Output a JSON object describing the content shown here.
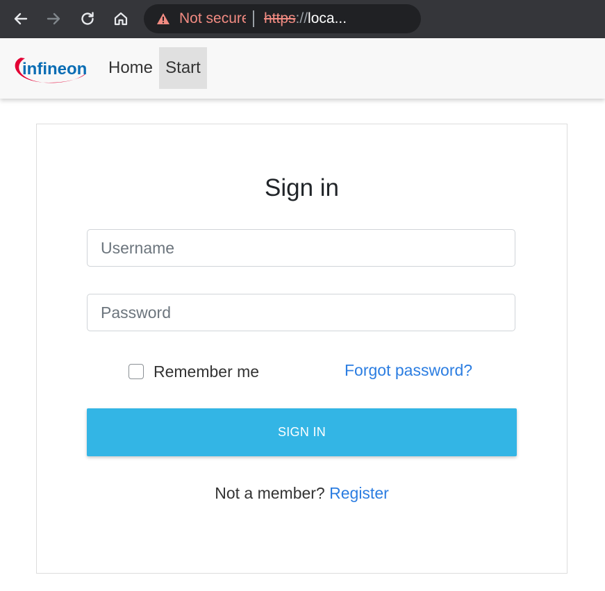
{
  "browser": {
    "security_text": "Not secure",
    "url_scheme": "https",
    "url_separator": "://",
    "url_host": "loca...",
    "icons": [
      "back-icon",
      "forward-icon",
      "reload-icon",
      "home-icon",
      "warning-icon"
    ]
  },
  "navbar": {
    "brand": "infineon",
    "items": [
      {
        "label": "Home"
      },
      {
        "label": "Start"
      }
    ],
    "active_bg": "#e0e0e0"
  },
  "form": {
    "title": "Sign in",
    "username_placeholder": "Username",
    "password_placeholder": "Password",
    "remember_label": "Remember me",
    "forgot_label": "Forgot password?",
    "submit_label": "SIGN IN",
    "member_text": "Not a member?",
    "register_label": "Register"
  },
  "colors": {
    "accent": "#33b5e5",
    "link": "#2b7de1",
    "warning": "#f28b82",
    "brand_red": "#e30034",
    "brand_blue": "#0a6db4"
  }
}
